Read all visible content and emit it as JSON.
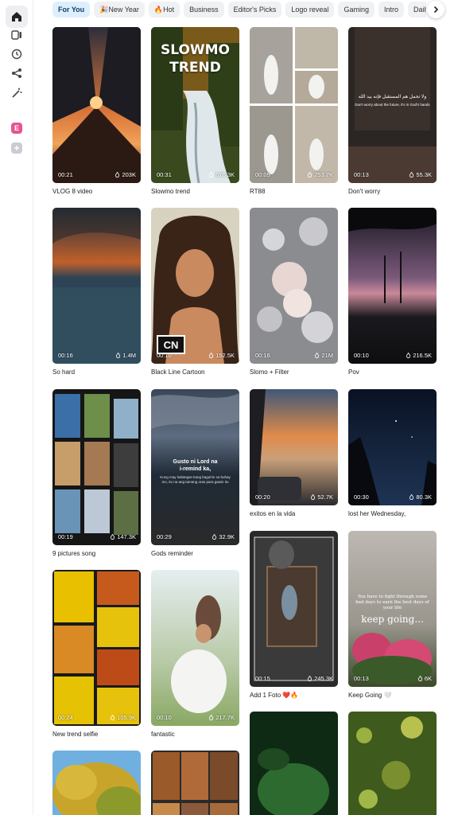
{
  "sidebar": {
    "items": [
      {
        "icon": "home-icon",
        "active": true
      },
      {
        "icon": "video-templates-icon",
        "active": false
      },
      {
        "icon": "history-icon",
        "active": false
      },
      {
        "icon": "share-icon",
        "active": false
      },
      {
        "icon": "magic-wand-icon",
        "active": false
      }
    ],
    "workspace_badge": "E",
    "add_label": "+"
  },
  "tabs": [
    "For You",
    "🎉New Year",
    "🔥Hot",
    "Business",
    "Editor's Picks",
    "Logo reveal",
    "Gaming",
    "Intro",
    "Daily VLOG"
  ],
  "active_tab": 0,
  "overlays": {
    "slowmo_line1": "SLOWMO",
    "slowmo_line2": "TREND",
    "dont_worry_arabic": "ولا تحمل هم المستقبل فإنه بيد الله",
    "dont_worry_en": "Don't worry about the future, it's in God's hands",
    "gods_line1": "Gusto ni Lord na",
    "gods_line2": "i-remind ka,",
    "gods_small": "Kung may kailangan kang baguhin sa buhay mo, ito na ang tamang oras para gawin ito",
    "keep_small": "You have to fight through some bad days to earn the best days of your life",
    "keep_big": "keep going...",
    "cn": "CN"
  },
  "cards": [
    {
      "title": "VLOG 8 video",
      "duration": "00:21",
      "uses": "203K"
    },
    {
      "title": "Slowmo trend",
      "duration": "00:31",
      "uses": "676.3K"
    },
    {
      "title": "RT88",
      "duration": "00:09",
      "uses": "253.7K"
    },
    {
      "title": "Don't worry",
      "duration": "00:13",
      "uses": "55.3K"
    },
    {
      "title": "So hard",
      "duration": "00:16",
      "uses": "1.4M"
    },
    {
      "title": "Black Line Cartoon",
      "duration": "00:10",
      "uses": "152.5K"
    },
    {
      "title": "Slomo + Filter",
      "duration": "00:16",
      "uses": "21M"
    },
    {
      "title": "Pov",
      "duration": "00:10",
      "uses": "216.5K"
    },
    {
      "title": "9 pictures song",
      "duration": "00:19",
      "uses": "147.3K"
    },
    {
      "title": "Gods reminder",
      "duration": "00:29",
      "uses": "32.9K"
    },
    {
      "title": "exitos en la vida",
      "duration": "00:20",
      "uses": "52.7K"
    },
    {
      "title": "lost her Wednesday,",
      "duration": "00:30",
      "uses": "80.3K"
    },
    {
      "title": "New trend selfie",
      "duration": "00:24",
      "uses": "105.9K"
    },
    {
      "title": "fantastic",
      "duration": "00:10",
      "uses": "217.7K"
    },
    {
      "title": "Add 1 Foto ❤️🔥",
      "duration": "00:15",
      "uses": "245.3K"
    },
    {
      "title": "Keep Going 🤍",
      "duration": "00:13",
      "uses": "6K"
    },
    {
      "title": "",
      "duration": "",
      "uses": ""
    },
    {
      "title": "",
      "duration": "",
      "uses": ""
    },
    {
      "title": "",
      "duration": "",
      "uses": ""
    },
    {
      "title": "",
      "duration": "",
      "uses": ""
    }
  ]
}
